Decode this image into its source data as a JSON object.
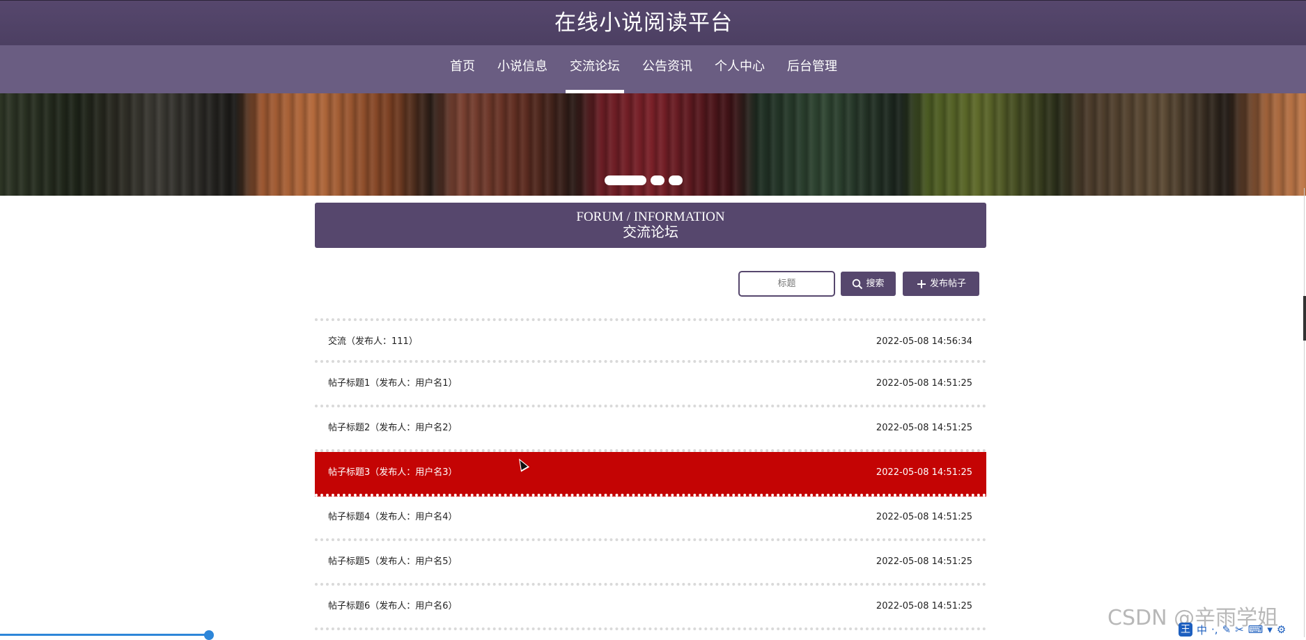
{
  "header": {
    "title": "在线小说阅读平台"
  },
  "nav": {
    "items": [
      {
        "label": "首页",
        "active": false
      },
      {
        "label": "小说信息",
        "active": false
      },
      {
        "label": "交流论坛",
        "active": true
      },
      {
        "label": "公告资讯",
        "active": false
      },
      {
        "label": "个人中心",
        "active": false
      },
      {
        "label": "后台管理",
        "active": false
      }
    ]
  },
  "carousel": {
    "slide_count": 3,
    "active_index": 0
  },
  "section": {
    "title_en": "FORUM / INFORMATION",
    "title_cn": "交流论坛"
  },
  "toolbar": {
    "search_placeholder": "标题",
    "search_label": "搜索",
    "post_label": "发布帖子"
  },
  "posts": [
    {
      "title": "交流（发布人：111）",
      "time": "2022-05-08 14:56:34"
    },
    {
      "title": "帖子标题1（发布人：用户名1）",
      "time": "2022-05-08 14:51:25"
    },
    {
      "title": "帖子标题2（发布人：用户名2）",
      "time": "2022-05-08 14:51:25"
    },
    {
      "title": "帖子标题3（发布人：用户名3）",
      "time": "2022-05-08 14:51:25"
    },
    {
      "title": "帖子标题4（发布人：用户名4）",
      "time": "2022-05-08 14:51:25"
    },
    {
      "title": "帖子标题5（发布人：用户名5）",
      "time": "2022-05-08 14:51:25"
    },
    {
      "title": "帖子标题6（发布人：用户名6）",
      "time": "2022-05-08 14:51:25"
    }
  ],
  "hovered_post_index": 3,
  "colors": {
    "primary": "#56476d",
    "nav_bg": "#6a5d82",
    "hover_row": "#c40404"
  },
  "watermark": "CSDN @辛雨学姐",
  "ime": {
    "logo": "王",
    "mode": "中"
  }
}
